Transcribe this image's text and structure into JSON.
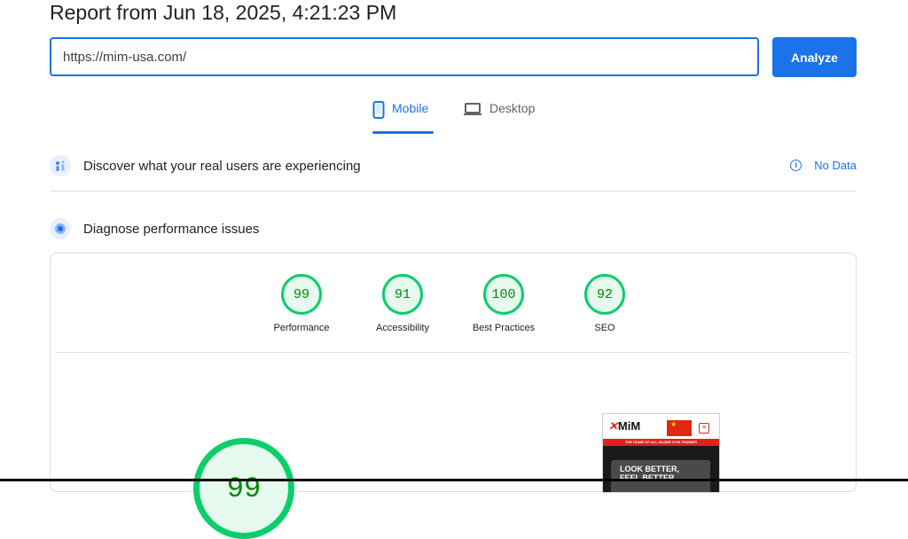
{
  "report": {
    "title": "Report from Jun 18, 2025, 4:21:23 PM"
  },
  "url_bar": {
    "value": "https://mim-usa.com/",
    "analyze_label": "Analyze"
  },
  "tabs": [
    {
      "label": "Mobile",
      "icon": "smartphone-icon",
      "active": true
    },
    {
      "label": "Desktop",
      "icon": "laptop-icon",
      "active": false
    }
  ],
  "sections": {
    "field": {
      "title": "Discover what your real users are experiencing",
      "status": "No Data"
    },
    "lab": {
      "title": "Diagnose performance issues"
    }
  },
  "scores": [
    {
      "label": "Performance",
      "value": "99"
    },
    {
      "label": "Accessibility",
      "value": "91"
    },
    {
      "label": "Best Practices",
      "value": "100"
    },
    {
      "label": "SEO",
      "value": "92"
    }
  ],
  "main_score": {
    "value": "99"
  },
  "screenshot": {
    "logo": "MiM",
    "banner": "THE HOME OF ALL-IN-ONE GYM TRAINER",
    "hero_line1": "LOOK BETTER,",
    "hero_line2": "FEEL BETTER"
  },
  "colors": {
    "accent": "#1a73e8",
    "pass": "#0cce6b",
    "pass_text": "#008800"
  }
}
